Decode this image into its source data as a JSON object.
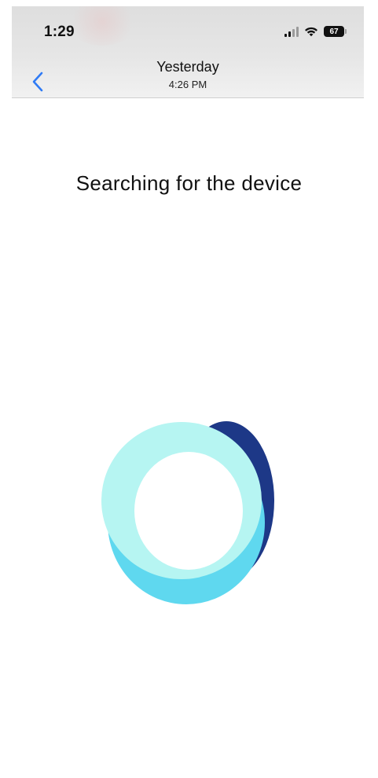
{
  "status_bar": {
    "time": "1:29",
    "battery": "67",
    "icons": [
      "cellular-signal-icon",
      "wifi-icon",
      "battery-icon"
    ]
  },
  "nav": {
    "back_icon": "chevron-left-icon",
    "title": "Yesterday",
    "subtitle": "4:26 PM"
  },
  "main": {
    "heading": "Searching for the device",
    "loading_icon": "searching-spinner-icon"
  },
  "colors": {
    "accent_back": "#2f7bf5",
    "spinner_dark": "#1d3887",
    "spinner_mid": "#5fd8ef",
    "spinner_light": "#b6f5f2"
  }
}
